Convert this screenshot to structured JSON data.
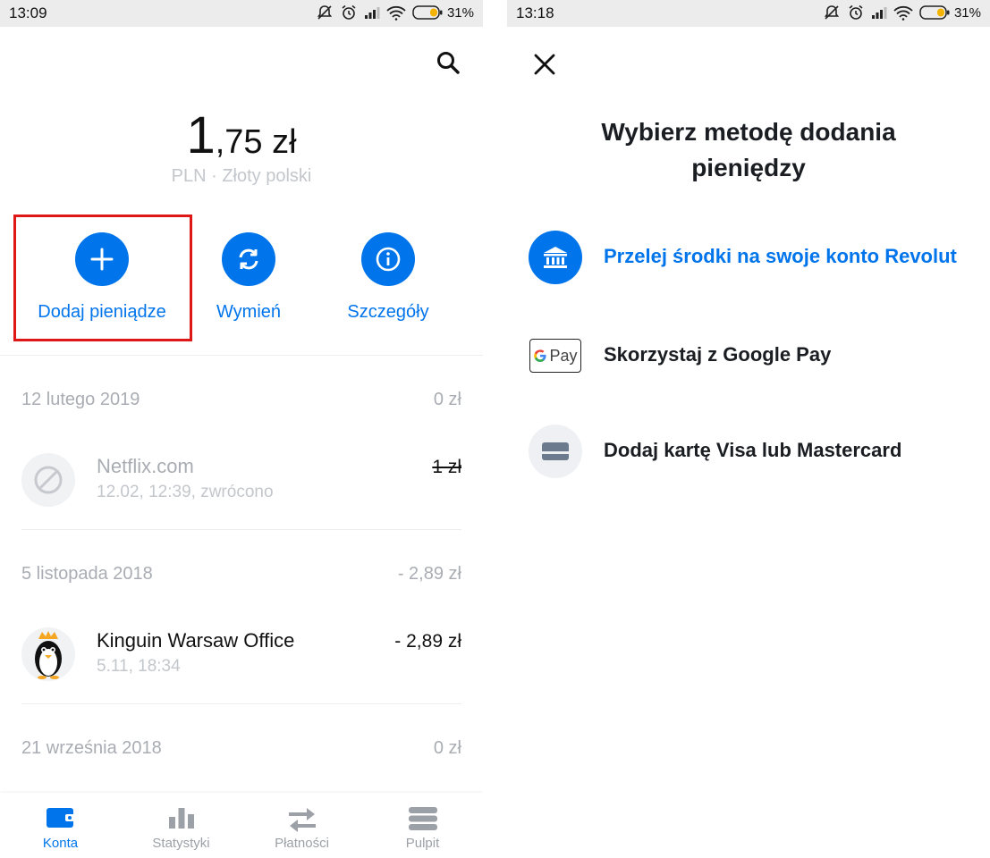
{
  "left": {
    "status": {
      "time": "13:09",
      "battery": "31%"
    },
    "balance": {
      "whole": "1",
      "fraction": ",75 zł",
      "currency": "PLN · Złoty polski"
    },
    "actions": {
      "add_money": "Dodaj pieniądze",
      "exchange": "Wymień",
      "details": "Szczegóły"
    },
    "transactions": [
      {
        "date": "12 lutego 2019",
        "date_total": "0 zł",
        "title": "Netflix.com",
        "subtitle": "12.02, 12:39, zwrócono",
        "amount": "1 zł"
      },
      {
        "date": "5 listopada 2018",
        "date_total": "- 2,89 zł",
        "title": "Kinguin Warsaw Office",
        "subtitle": "5.11, 18:34",
        "amount": "- 2,89 zł"
      },
      {
        "date": "21 września 2018",
        "date_total": "0 zł"
      }
    ],
    "nav": {
      "accounts": "Konta",
      "stats": "Statystyki",
      "payments": "Płatności",
      "dashboard": "Pulpit"
    }
  },
  "right": {
    "status": {
      "time": "13:18",
      "battery": "31%"
    },
    "title_line1": "Wybierz metodę dodania",
    "title_line2": "pieniędzy",
    "methods": {
      "bank_transfer": "Przelej środki na swoje konto Revolut",
      "google_pay_badge": "Pay",
      "google_pay": "Skorzystaj z Google Pay",
      "card": "Dodaj kartę Visa lub Mastercard"
    }
  },
  "colors": {
    "accent": "#0075eb",
    "highlight": "#e01717",
    "muted": "#a9adb3"
  },
  "icons": [
    "search-icon",
    "plus-icon",
    "exchange-icon",
    "info-icon",
    "blocked-icon",
    "penguin-icon",
    "wallet-icon",
    "bar-chart-icon",
    "transfer-arrows-icon",
    "cards-stack-icon",
    "close-icon",
    "bank-icon",
    "google-pay-icon",
    "card-icon"
  ]
}
